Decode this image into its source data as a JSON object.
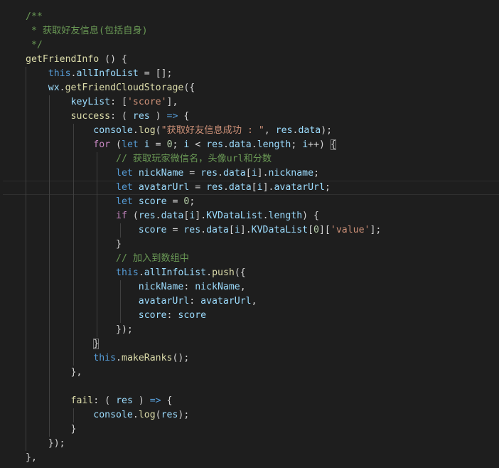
{
  "editor": {
    "theme": "dark",
    "background": "#1e1e1e",
    "colors": {
      "comment": "#6a9955",
      "function": "#dcdcaa",
      "keyword": "#569cd6",
      "control": "#c586c0",
      "variable": "#9cdcfe",
      "string": "#ce9178",
      "number": "#b5cea8",
      "text": "#d4d4d4"
    },
    "lines": [
      [
        {
          "t": "/**",
          "c": "comment"
        }
      ],
      [
        {
          "t": " * 获取好友信息(包括自身)",
          "c": "comment"
        }
      ],
      [
        {
          "t": " */",
          "c": "comment"
        }
      ],
      [
        {
          "t": "getFriendInfo",
          "c": "func"
        },
        {
          "t": " () {",
          "c": "plain"
        }
      ],
      [
        {
          "t": "    ",
          "c": "plain"
        },
        {
          "t": "this",
          "c": "kw"
        },
        {
          "t": ".",
          "c": "plain"
        },
        {
          "t": "allInfoList",
          "c": "var"
        },
        {
          "t": " = [];",
          "c": "plain"
        }
      ],
      [
        {
          "t": "    ",
          "c": "plain"
        },
        {
          "t": "wx",
          "c": "var"
        },
        {
          "t": ".",
          "c": "plain"
        },
        {
          "t": "getFriendCloudStorage",
          "c": "func"
        },
        {
          "t": "({",
          "c": "plain"
        }
      ],
      [
        {
          "t": "        ",
          "c": "plain"
        },
        {
          "t": "keyList",
          "c": "var"
        },
        {
          "t": ": [",
          "c": "plain"
        },
        {
          "t": "'score'",
          "c": "str"
        },
        {
          "t": "],",
          "c": "plain"
        }
      ],
      [
        {
          "t": "        ",
          "c": "plain"
        },
        {
          "t": "success",
          "c": "func"
        },
        {
          "t": ": ( ",
          "c": "plain"
        },
        {
          "t": "res",
          "c": "var"
        },
        {
          "t": " ) ",
          "c": "plain"
        },
        {
          "t": "=>",
          "c": "kw"
        },
        {
          "t": " {",
          "c": "plain"
        }
      ],
      [
        {
          "t": "            ",
          "c": "plain"
        },
        {
          "t": "console",
          "c": "var"
        },
        {
          "t": ".",
          "c": "plain"
        },
        {
          "t": "log",
          "c": "func"
        },
        {
          "t": "(",
          "c": "plain"
        },
        {
          "t": "\"获取好友信息成功 : \"",
          "c": "str"
        },
        {
          "t": ", ",
          "c": "plain"
        },
        {
          "t": "res",
          "c": "var"
        },
        {
          "t": ".",
          "c": "plain"
        },
        {
          "t": "data",
          "c": "var"
        },
        {
          "t": ");",
          "c": "plain"
        }
      ],
      [
        {
          "t": "            ",
          "c": "plain"
        },
        {
          "t": "for",
          "c": "ctrl"
        },
        {
          "t": " (",
          "c": "plain"
        },
        {
          "t": "let",
          "c": "kw"
        },
        {
          "t": " ",
          "c": "plain"
        },
        {
          "t": "i",
          "c": "var"
        },
        {
          "t": " = ",
          "c": "plain"
        },
        {
          "t": "0",
          "c": "num"
        },
        {
          "t": "; ",
          "c": "plain"
        },
        {
          "t": "i",
          "c": "var"
        },
        {
          "t": " < ",
          "c": "plain"
        },
        {
          "t": "res",
          "c": "var"
        },
        {
          "t": ".",
          "c": "plain"
        },
        {
          "t": "data",
          "c": "var"
        },
        {
          "t": ".",
          "c": "plain"
        },
        {
          "t": "length",
          "c": "var"
        },
        {
          "t": "; ",
          "c": "plain"
        },
        {
          "t": "i",
          "c": "var"
        },
        {
          "t": "++) ",
          "c": "plain"
        },
        {
          "t": "{",
          "c": "plain",
          "box": true
        }
      ],
      [
        {
          "t": "                ",
          "c": "plain"
        },
        {
          "t": "// 获取玩家微信名，头像url和分数",
          "c": "comment"
        }
      ],
      [
        {
          "t": "                ",
          "c": "plain"
        },
        {
          "t": "let",
          "c": "kw"
        },
        {
          "t": " ",
          "c": "plain"
        },
        {
          "t": "nickName",
          "c": "var"
        },
        {
          "t": " = ",
          "c": "plain"
        },
        {
          "t": "res",
          "c": "var"
        },
        {
          "t": ".",
          "c": "plain"
        },
        {
          "t": "data",
          "c": "var"
        },
        {
          "t": "[",
          "c": "plain"
        },
        {
          "t": "i",
          "c": "var"
        },
        {
          "t": "].",
          "c": "plain"
        },
        {
          "t": "nickname",
          "c": "var"
        },
        {
          "t": ";",
          "c": "plain"
        }
      ],
      [
        {
          "t": "                ",
          "c": "plain"
        },
        {
          "t": "let",
          "c": "kw"
        },
        {
          "t": " ",
          "c": "plain"
        },
        {
          "t": "avatarUrl",
          "c": "var"
        },
        {
          "t": " = ",
          "c": "plain"
        },
        {
          "t": "res",
          "c": "var"
        },
        {
          "t": ".",
          "c": "plain"
        },
        {
          "t": "data",
          "c": "var"
        },
        {
          "t": "[",
          "c": "plain"
        },
        {
          "t": "i",
          "c": "var"
        },
        {
          "t": "].",
          "c": "plain"
        },
        {
          "t": "avatarUrl",
          "c": "var"
        },
        {
          "t": ";",
          "c": "plain"
        }
      ],
      [
        {
          "t": "                ",
          "c": "plain"
        },
        {
          "t": "let",
          "c": "kw"
        },
        {
          "t": " ",
          "c": "plain"
        },
        {
          "t": "score",
          "c": "var"
        },
        {
          "t": " = ",
          "c": "plain"
        },
        {
          "t": "0",
          "c": "num"
        },
        {
          "t": ";",
          "c": "plain"
        }
      ],
      [
        {
          "t": "                ",
          "c": "plain"
        },
        {
          "t": "if",
          "c": "ctrl"
        },
        {
          "t": " (",
          "c": "plain"
        },
        {
          "t": "res",
          "c": "var"
        },
        {
          "t": ".",
          "c": "plain"
        },
        {
          "t": "data",
          "c": "var"
        },
        {
          "t": "[",
          "c": "plain"
        },
        {
          "t": "i",
          "c": "var"
        },
        {
          "t": "].",
          "c": "plain"
        },
        {
          "t": "KVDataList",
          "c": "var"
        },
        {
          "t": ".",
          "c": "plain"
        },
        {
          "t": "length",
          "c": "var"
        },
        {
          "t": ") {",
          "c": "plain"
        }
      ],
      [
        {
          "t": "                    ",
          "c": "plain"
        },
        {
          "t": "score",
          "c": "var"
        },
        {
          "t": " = ",
          "c": "plain"
        },
        {
          "t": "res",
          "c": "var"
        },
        {
          "t": ".",
          "c": "plain"
        },
        {
          "t": "data",
          "c": "var"
        },
        {
          "t": "[",
          "c": "plain"
        },
        {
          "t": "i",
          "c": "var"
        },
        {
          "t": "].",
          "c": "plain"
        },
        {
          "t": "KVDataList",
          "c": "var"
        },
        {
          "t": "[",
          "c": "plain"
        },
        {
          "t": "0",
          "c": "num"
        },
        {
          "t": "][",
          "c": "plain"
        },
        {
          "t": "'value'",
          "c": "str"
        },
        {
          "t": "];",
          "c": "plain"
        }
      ],
      [
        {
          "t": "                }",
          "c": "plain"
        }
      ],
      [
        {
          "t": "                ",
          "c": "plain"
        },
        {
          "t": "// 加入到数组中",
          "c": "comment"
        }
      ],
      [
        {
          "t": "                ",
          "c": "plain"
        },
        {
          "t": "this",
          "c": "kw"
        },
        {
          "t": ".",
          "c": "plain"
        },
        {
          "t": "allInfoList",
          "c": "var"
        },
        {
          "t": ".",
          "c": "plain"
        },
        {
          "t": "push",
          "c": "func"
        },
        {
          "t": "({",
          "c": "plain"
        }
      ],
      [
        {
          "t": "                    ",
          "c": "plain"
        },
        {
          "t": "nickName",
          "c": "var"
        },
        {
          "t": ": ",
          "c": "plain"
        },
        {
          "t": "nickName",
          "c": "var"
        },
        {
          "t": ",",
          "c": "plain"
        }
      ],
      [
        {
          "t": "                    ",
          "c": "plain"
        },
        {
          "t": "avatarUrl",
          "c": "var"
        },
        {
          "t": ": ",
          "c": "plain"
        },
        {
          "t": "avatarUrl",
          "c": "var"
        },
        {
          "t": ",",
          "c": "plain"
        }
      ],
      [
        {
          "t": "                    ",
          "c": "plain"
        },
        {
          "t": "score",
          "c": "var"
        },
        {
          "t": ": ",
          "c": "plain"
        },
        {
          "t": "score",
          "c": "var"
        }
      ],
      [
        {
          "t": "                });",
          "c": "plain"
        }
      ],
      [
        {
          "t": "            ",
          "c": "plain"
        },
        {
          "t": "}",
          "c": "plain",
          "box": true
        }
      ],
      [
        {
          "t": "            ",
          "c": "plain"
        },
        {
          "t": "this",
          "c": "kw"
        },
        {
          "t": ".",
          "c": "plain"
        },
        {
          "t": "makeRanks",
          "c": "func"
        },
        {
          "t": "();",
          "c": "plain"
        }
      ],
      [
        {
          "t": "        },",
          "c": "plain"
        }
      ],
      [
        {
          "t": "",
          "c": "plain"
        }
      ],
      [
        {
          "t": "        ",
          "c": "plain"
        },
        {
          "t": "fail",
          "c": "func"
        },
        {
          "t": ": ( ",
          "c": "plain"
        },
        {
          "t": "res",
          "c": "var"
        },
        {
          "t": " ) ",
          "c": "plain"
        },
        {
          "t": "=>",
          "c": "kw"
        },
        {
          "t": " {",
          "c": "plain"
        }
      ],
      [
        {
          "t": "            ",
          "c": "plain"
        },
        {
          "t": "console",
          "c": "var"
        },
        {
          "t": ".",
          "c": "plain"
        },
        {
          "t": "log",
          "c": "func"
        },
        {
          "t": "(",
          "c": "plain"
        },
        {
          "t": "res",
          "c": "var"
        },
        {
          "t": ");",
          "c": "plain"
        }
      ],
      [
        {
          "t": "        }",
          "c": "plain"
        }
      ],
      [
        {
          "t": "    });",
          "c": "plain"
        }
      ],
      [
        {
          "t": "},",
          "c": "plain"
        }
      ]
    ]
  }
}
